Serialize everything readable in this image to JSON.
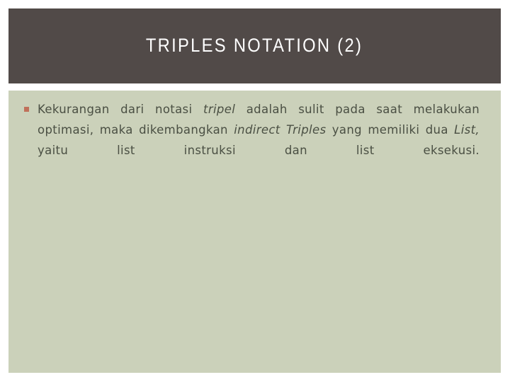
{
  "slide": {
    "title": "TRIPLES NOTATION (2)",
    "title_color": "#FFFFFF",
    "title_band_color": "#514A48",
    "content_background_color": "#CBD1BA",
    "body_text_color": "#4A4F43",
    "bullet_marker_color": "#C0705A",
    "page_background_color": "#FFFFFF"
  },
  "body": {
    "bullets": [
      {
        "marker": "square-bullet-icon",
        "segments": [
          {
            "text": "Kekurangan dari notasi ",
            "style": "normal"
          },
          {
            "text": "tripel",
            "style": "italic"
          },
          {
            "text": " adalah sulit pada saat melakukan optimasi, maka dikembangkan ",
            "style": "normal"
          },
          {
            "text": "indirect Triples",
            "style": "italic"
          },
          {
            "text": " yang memiliki dua ",
            "style": "normal"
          },
          {
            "text": "List,",
            "style": "italic"
          },
          {
            "text": " yaitu list instruksi dan list eksekusi.",
            "style": "normal"
          }
        ],
        "plain_text": "Kekurangan dari notasi tripel adalah sulit pada saat melakukan optimasi, maka dikembangkan indirect Triples yang memiliki dua List, yaitu list instruksi dan list eksekusi."
      }
    ]
  }
}
